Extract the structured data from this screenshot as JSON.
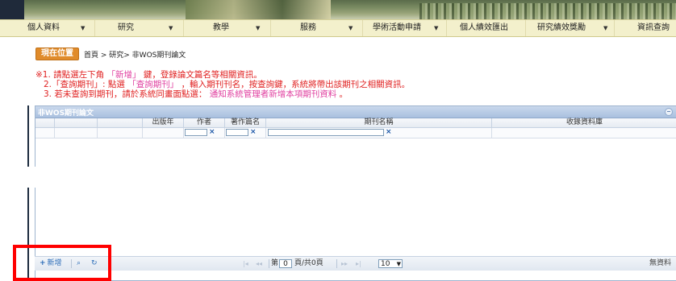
{
  "navbar": {
    "items": [
      {
        "label": "個人資料",
        "dropdown": true
      },
      {
        "label": "研究",
        "dropdown": true
      },
      {
        "label": "教學",
        "dropdown": true
      },
      {
        "label": "服務",
        "dropdown": true
      },
      {
        "label": "學術活動申請",
        "dropdown": true
      },
      {
        "label": "個人績效匯出",
        "dropdown": false
      },
      {
        "label": "研究績效獎勵",
        "dropdown": true
      },
      {
        "label": "資訊查詢",
        "dropdown": false
      }
    ]
  },
  "breadcrumb": {
    "badge": "現在位置",
    "path": "首頁 > 研究> 非WOS期刊論文"
  },
  "instructions": {
    "line1_a": "※1. 請點選左下角",
    "line1_b": "「新增」",
    "line1_c": "鍵，登錄論文篇名等相關資訊。",
    "line2_a": "2.「查詢期刊」: 點選",
    "line2_b": "「查詢期刊」",
    "line2_c": "，輸入期刊刊名，按查詢鍵，系統將帶出該期刊之相關資訊。",
    "line3_a": "3. 若未查詢到期刊，請於系統同畫面點選：",
    "line3_b": "通知系統管理者新增本項期刊資料",
    "line3_c": "。"
  },
  "grid": {
    "title": "非WOS期刊論文",
    "columns": [
      "",
      "",
      "",
      "出版年",
      "作者",
      "著作篇名",
      "期刊名稱",
      "收錄資料庫"
    ],
    "filter_clear": "×"
  },
  "pager": {
    "add_label": "新增",
    "search_icon": "⌕",
    "refresh_icon": "↻",
    "first": "|◂",
    "prev": "◂◂",
    "page_prefix": "第",
    "page_value": "0",
    "page_suffix": "頁/共0頁",
    "next": "▸▸",
    "last": "▸|",
    "page_size": "10",
    "no_records": "無資料"
  },
  "colors": {
    "accent_orange": "#e08b2a",
    "instruction_red": "#e02020",
    "instruction_pink": "#e040a0",
    "highlight_frame": "#ff0000"
  }
}
